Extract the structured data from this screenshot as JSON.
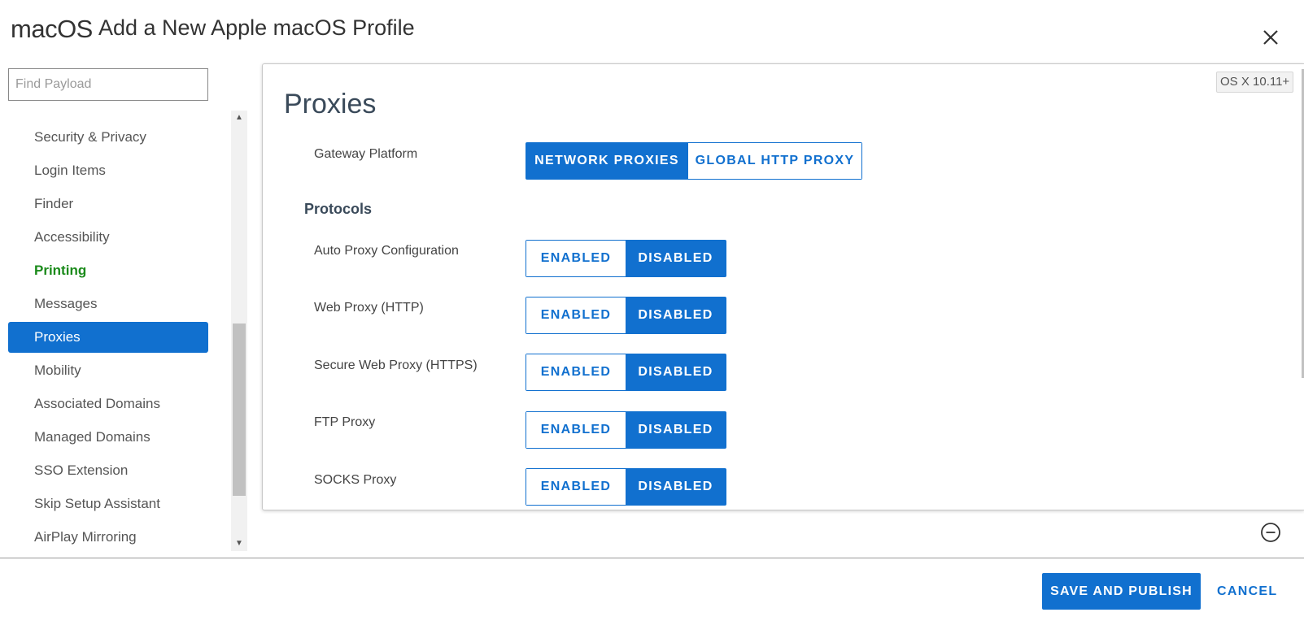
{
  "header": {
    "brand": "macOS",
    "title": "Add a New Apple macOS Profile",
    "close_icon": "close-icon"
  },
  "sidebar": {
    "search_placeholder": "Find Payload",
    "items": [
      {
        "label": "Security & Privacy",
        "state": "normal"
      },
      {
        "label": "Login Items",
        "state": "normal"
      },
      {
        "label": "Finder",
        "state": "normal"
      },
      {
        "label": "Accessibility",
        "state": "normal"
      },
      {
        "label": "Printing",
        "state": "configured"
      },
      {
        "label": "Messages",
        "state": "normal"
      },
      {
        "label": "Proxies",
        "state": "selected"
      },
      {
        "label": "Mobility",
        "state": "normal"
      },
      {
        "label": "Associated Domains",
        "state": "normal"
      },
      {
        "label": "Managed Domains",
        "state": "normal"
      },
      {
        "label": "SSO Extension",
        "state": "normal"
      },
      {
        "label": "Skip Setup Assistant",
        "state": "normal"
      },
      {
        "label": "AirPlay Mirroring",
        "state": "normal"
      }
    ]
  },
  "panel": {
    "os_badge": "OS X 10.11+",
    "title": "Proxies",
    "gateway": {
      "label": "Gateway Platform",
      "options": [
        "NETWORK PROXIES",
        "GLOBAL HTTP PROXY"
      ],
      "selected": "NETWORK PROXIES"
    },
    "protocols_heading": "Protocols",
    "protocols": [
      {
        "label": "Auto Proxy Configuration",
        "enabled_label": "ENABLED",
        "disabled_label": "DISABLED",
        "selected": "DISABLED"
      },
      {
        "label": "Web Proxy (HTTP)",
        "enabled_label": "ENABLED",
        "disabled_label": "DISABLED",
        "selected": "DISABLED"
      },
      {
        "label": "Secure Web Proxy (HTTPS)",
        "enabled_label": "ENABLED",
        "disabled_label": "DISABLED",
        "selected": "DISABLED"
      },
      {
        "label": "FTP Proxy",
        "enabled_label": "ENABLED",
        "disabled_label": "DISABLED",
        "selected": "DISABLED"
      },
      {
        "label": "SOCKS Proxy",
        "enabled_label": "ENABLED",
        "disabled_label": "DISABLED",
        "selected": "DISABLED"
      }
    ],
    "remove_icon": "minus-circle-icon"
  },
  "footer": {
    "save_label": "SAVE AND PUBLISH",
    "cancel_label": "CANCEL"
  },
  "colors": {
    "accent": "#1170cf",
    "configured": "#1a8a1a",
    "text": "#333333"
  }
}
